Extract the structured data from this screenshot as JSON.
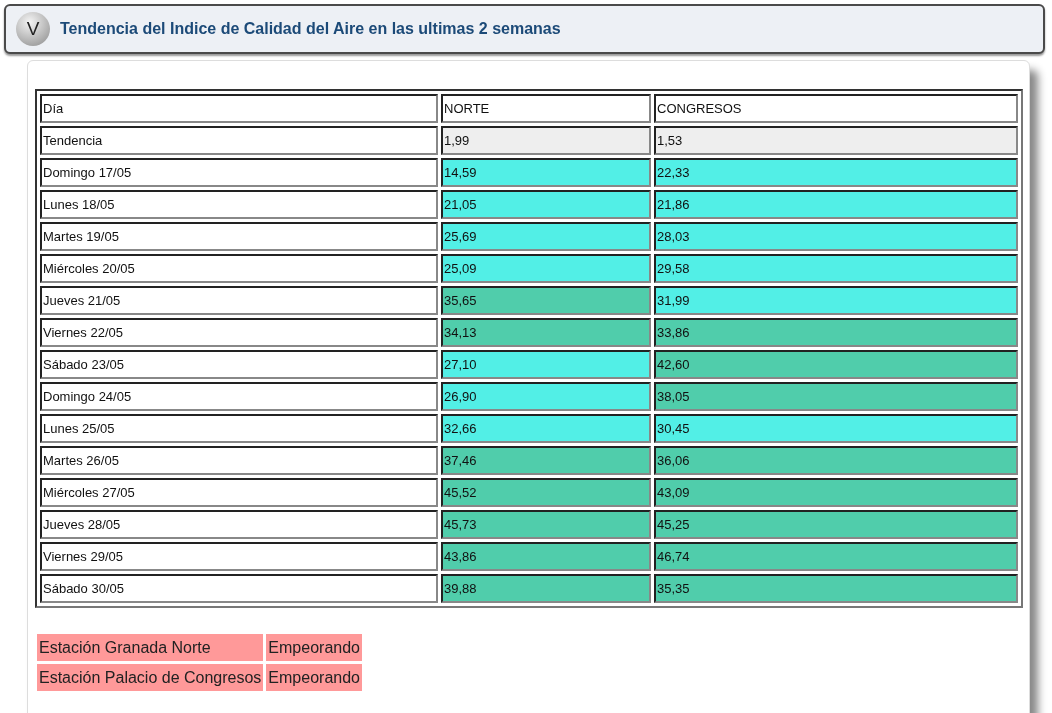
{
  "header": {
    "toggle": "V",
    "title": "Tendencia del Indice de Calidad del Aire en las ultimas 2 semanas"
  },
  "table": {
    "columns": [
      "Día",
      "NORTE",
      "CONGRESOS"
    ],
    "rows": [
      {
        "cells": [
          {
            "value": "Tendencia"
          },
          {
            "value": "1,99",
            "color": "#eeeeee"
          },
          {
            "value": "1,53",
            "color": "#eeeeee"
          }
        ]
      },
      {
        "cells": [
          {
            "value": "Domingo 17/05"
          },
          {
            "value": "14,59",
            "color": "#52efe6"
          },
          {
            "value": "22,33",
            "color": "#52efe6"
          }
        ]
      },
      {
        "cells": [
          {
            "value": "Lunes 18/05"
          },
          {
            "value": "21,05",
            "color": "#52efe6"
          },
          {
            "value": "21,86",
            "color": "#52efe6"
          }
        ]
      },
      {
        "cells": [
          {
            "value": "Martes 19/05"
          },
          {
            "value": "25,69",
            "color": "#52efe6"
          },
          {
            "value": "28,03",
            "color": "#52efe6"
          }
        ]
      },
      {
        "cells": [
          {
            "value": "Miércoles 20/05"
          },
          {
            "value": "25,09",
            "color": "#52efe6"
          },
          {
            "value": "29,58",
            "color": "#52efe6"
          }
        ]
      },
      {
        "cells": [
          {
            "value": "Jueves 21/05"
          },
          {
            "value": "35,65",
            "color": "#50cdab"
          },
          {
            "value": "31,99",
            "color": "#52efe6"
          }
        ]
      },
      {
        "cells": [
          {
            "value": "Viernes 22/05"
          },
          {
            "value": "34,13",
            "color": "#50cdab"
          },
          {
            "value": "33,86",
            "color": "#50cdab"
          }
        ]
      },
      {
        "cells": [
          {
            "value": "Sábado 23/05"
          },
          {
            "value": "27,10",
            "color": "#52efe6"
          },
          {
            "value": "42,60",
            "color": "#50cdab"
          }
        ]
      },
      {
        "cells": [
          {
            "value": "Domingo 24/05"
          },
          {
            "value": "26,90",
            "color": "#52efe6"
          },
          {
            "value": "38,05",
            "color": "#50cdab"
          }
        ]
      },
      {
        "cells": [
          {
            "value": "Lunes 25/05"
          },
          {
            "value": "32,66",
            "color": "#52efe6"
          },
          {
            "value": "30,45",
            "color": "#52efe6"
          }
        ]
      },
      {
        "cells": [
          {
            "value": "Martes 26/05"
          },
          {
            "value": "37,46",
            "color": "#50cdab"
          },
          {
            "value": "36,06",
            "color": "#50cdab"
          }
        ]
      },
      {
        "cells": [
          {
            "value": "Miércoles 27/05"
          },
          {
            "value": "45,52",
            "color": "#50cdab"
          },
          {
            "value": "43,09",
            "color": "#50cdab"
          }
        ]
      },
      {
        "cells": [
          {
            "value": "Jueves 28/05"
          },
          {
            "value": "45,73",
            "color": "#50cdab"
          },
          {
            "value": "45,25",
            "color": "#50cdab"
          }
        ]
      },
      {
        "cells": [
          {
            "value": "Viernes 29/05"
          },
          {
            "value": "43,86",
            "color": "#50cdab"
          },
          {
            "value": "46,74",
            "color": "#50cdab"
          }
        ]
      },
      {
        "cells": [
          {
            "value": "Sábado 30/05"
          },
          {
            "value": "39,88",
            "color": "#50cdab"
          },
          {
            "value": "35,35",
            "color": "#50cdab"
          }
        ]
      }
    ]
  },
  "stations": [
    {
      "name": "Estación Granada Norte",
      "trend": "Empeorando"
    },
    {
      "name": "Estación Palacio de Congresos",
      "trend": "Empeorando"
    }
  ]
}
